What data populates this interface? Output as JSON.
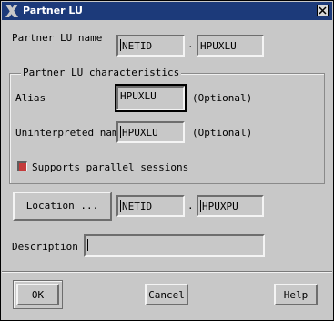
{
  "window": {
    "title": "Partner LU"
  },
  "partner_lu_name": {
    "label": "Partner LU name",
    "network": "NETID",
    "separator": ".",
    "lu": "HPUXLU"
  },
  "characteristics": {
    "group_label": "Partner LU characteristics",
    "alias_label": "Alias",
    "alias_value": "HPUXLU",
    "alias_hint": "(Optional)",
    "uninterpreted_label": "Uninterpreted name",
    "uninterpreted_value": "HPUXLU",
    "uninterpreted_hint": "(Optional)",
    "parallel_sessions_label": "Supports parallel sessions",
    "parallel_sessions_checked": true
  },
  "location": {
    "button_label": "Location ...",
    "network": "NETID",
    "separator": ".",
    "cp": "HPUXPU"
  },
  "description": {
    "label": "Description",
    "value": ""
  },
  "buttons": {
    "ok": "OK",
    "cancel": "Cancel",
    "help": "Help"
  },
  "colors": {
    "titlebar": "#1c3a7a",
    "background": "#c8c8c8",
    "checkbox": "#c43a3a"
  }
}
